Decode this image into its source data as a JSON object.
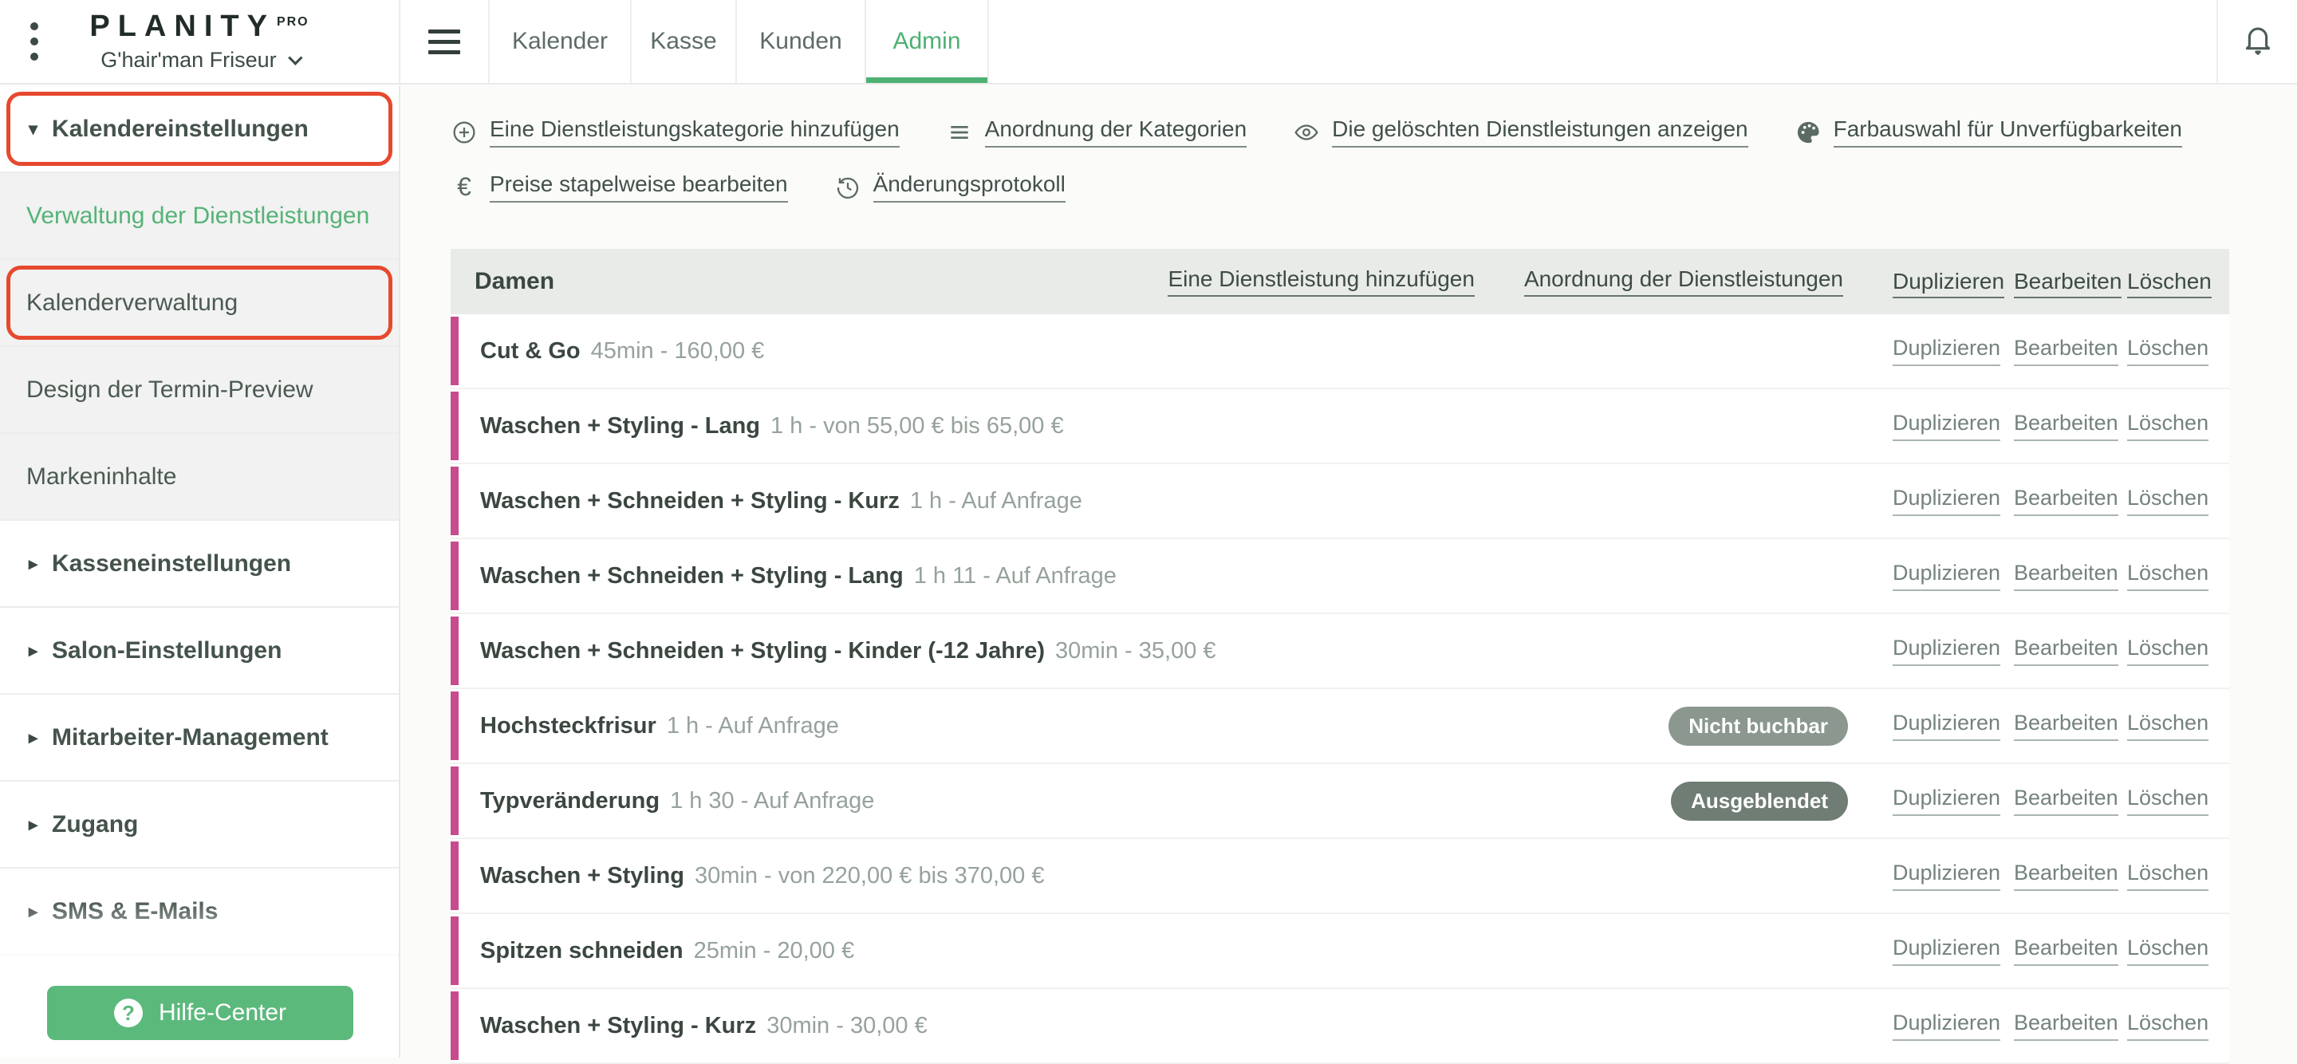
{
  "topbar": {
    "brand": "PLANITY",
    "brand_sup": "PRO",
    "salon_name": "G'hair'man Friseur",
    "menu_icon": "kebab-menu",
    "nav_icon": "hamburger",
    "notifications_icon": "bell",
    "tabs": [
      {
        "label": "Kalender",
        "active": false
      },
      {
        "label": "Kasse",
        "active": false
      },
      {
        "label": "Kunden",
        "active": false
      },
      {
        "label": "Admin",
        "active": true
      }
    ]
  },
  "sidebar": {
    "items": [
      {
        "label": "Kalendereinstellungen",
        "type": "section-open",
        "highlighted": true
      },
      {
        "label": "Verwaltung der Dienstleistungen",
        "type": "sub-active",
        "highlighted": false
      },
      {
        "label": "Kalenderverwaltung",
        "type": "sub",
        "highlighted": true
      },
      {
        "label": "Design der Termin-Preview",
        "type": "sub",
        "highlighted": false
      },
      {
        "label": "Markeninhalte",
        "type": "sub",
        "highlighted": false
      },
      {
        "label": "Kasseneinstellungen",
        "type": "section",
        "highlighted": false
      },
      {
        "label": "Salon-Einstellungen",
        "type": "section",
        "highlighted": false
      },
      {
        "label": "Mitarbeiter-Management",
        "type": "section",
        "highlighted": false
      },
      {
        "label": "Zugang",
        "type": "section",
        "highlighted": false
      },
      {
        "label": "SMS & E-Mails",
        "type": "section",
        "highlighted": false
      }
    ],
    "help_button": {
      "label": "Hilfe-Center",
      "icon": "question-circle"
    }
  },
  "toolbar": {
    "row1": [
      {
        "icon": "plus-circle",
        "label": "Eine Dienstleistungskategorie hinzufügen"
      },
      {
        "icon": "list",
        "label": "Anordnung der Kategorien"
      },
      {
        "icon": "eye",
        "label": "Die gelöschten Dienstleistungen anzeigen"
      },
      {
        "icon": "palette",
        "label": "Farbauswahl für Unverfügbarkeiten"
      }
    ],
    "row2": [
      {
        "icon": "euro",
        "label": "Preise stapelweise bearbeiten"
      },
      {
        "icon": "history",
        "label": "Änderungsprotokoll"
      }
    ]
  },
  "table": {
    "category": "Damen",
    "header_links": {
      "add": "Eine Dienstleistung hinzufügen",
      "order": "Anordnung der Dienstleistungen",
      "duplicate": "Duplizieren",
      "edit": "Bearbeiten",
      "delete": "Löschen"
    },
    "row_links": {
      "duplicate": "Duplizieren",
      "edit": "Bearbeiten",
      "delete": "Löschen"
    },
    "rows": [
      {
        "name": "Cut & Go",
        "meta": "45min - 160,00 €",
        "badge": null
      },
      {
        "name": "Waschen + Styling - Lang",
        "meta": "1 h - von 55,00 € bis 65,00 €",
        "badge": null
      },
      {
        "name": "Waschen + Schneiden + Styling - Kurz",
        "meta": "1 h - Auf Anfrage",
        "badge": null
      },
      {
        "name": "Waschen + Schneiden + Styling - Lang",
        "meta": "1 h 11 - Auf Anfrage",
        "badge": null
      },
      {
        "name": "Waschen + Schneiden + Styling - Kinder (-12 Jahre)",
        "meta": "30min - 35,00 €",
        "badge": null
      },
      {
        "name": "Hochsteckfrisur",
        "meta": "1 h - Auf Anfrage",
        "badge": {
          "text": "Nicht buchbar",
          "tone": "light"
        }
      },
      {
        "name": "Typveränderung",
        "meta": "1 h 30 - Auf Anfrage",
        "badge": {
          "text": "Ausgeblendet",
          "tone": "dark"
        }
      },
      {
        "name": "Waschen + Styling",
        "meta": "30min - von 220,00 € bis 370,00 €",
        "badge": null
      },
      {
        "name": "Spitzen schneiden",
        "meta": "25min - 20,00 €",
        "badge": null
      },
      {
        "name": "Waschen + Styling - Kurz",
        "meta": "30min - 30,00 €",
        "badge": null
      }
    ]
  },
  "colors": {
    "accent_green": "#4db173",
    "button_green": "#5cb97c",
    "category_pink": "#c74b8e",
    "annotation_red": "#e6492e",
    "badge_light": "#8b978f",
    "badge_dark": "#6f7d74",
    "table_header_bg": "#e9ebe9"
  }
}
